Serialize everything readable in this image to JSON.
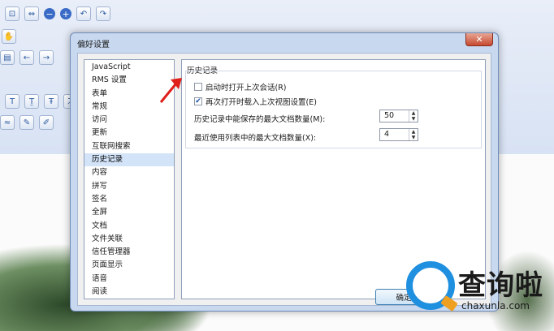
{
  "dialog": {
    "title": "偏好设置",
    "close_icon": "close-icon"
  },
  "categories": [
    "JavaScript",
    "RMS 设置",
    "表单",
    "常规",
    "访问",
    "更新",
    "互联网搜索",
    "历史记录",
    "内容",
    "拼写",
    "签名",
    "全屏",
    "文档",
    "文件关联",
    "信任管理器",
    "页面显示",
    "语音",
    "阅读"
  ],
  "selected_category": "历史记录",
  "history": {
    "group_title": "历史记录",
    "option_restore_session": {
      "label": "启动时打开上次会话(R)",
      "checked": false
    },
    "option_restore_view": {
      "label": "再次打开时载入上次视图设置(E)",
      "checked": true
    },
    "max_history_label": "历史记录中能保存的最大文档数量(M):",
    "max_history_value": "50",
    "max_recent_label": "最近使用列表中的最大文档数量(X):",
    "max_recent_value": "4"
  },
  "buttons": {
    "ok_label": "确定"
  },
  "watermark": {
    "brand": "查询啦",
    "url": "chaxunla.com"
  },
  "colors": {
    "accent": "#1f8fe0",
    "arrow": "#e0201a",
    "selection": "#d3e3f8"
  }
}
